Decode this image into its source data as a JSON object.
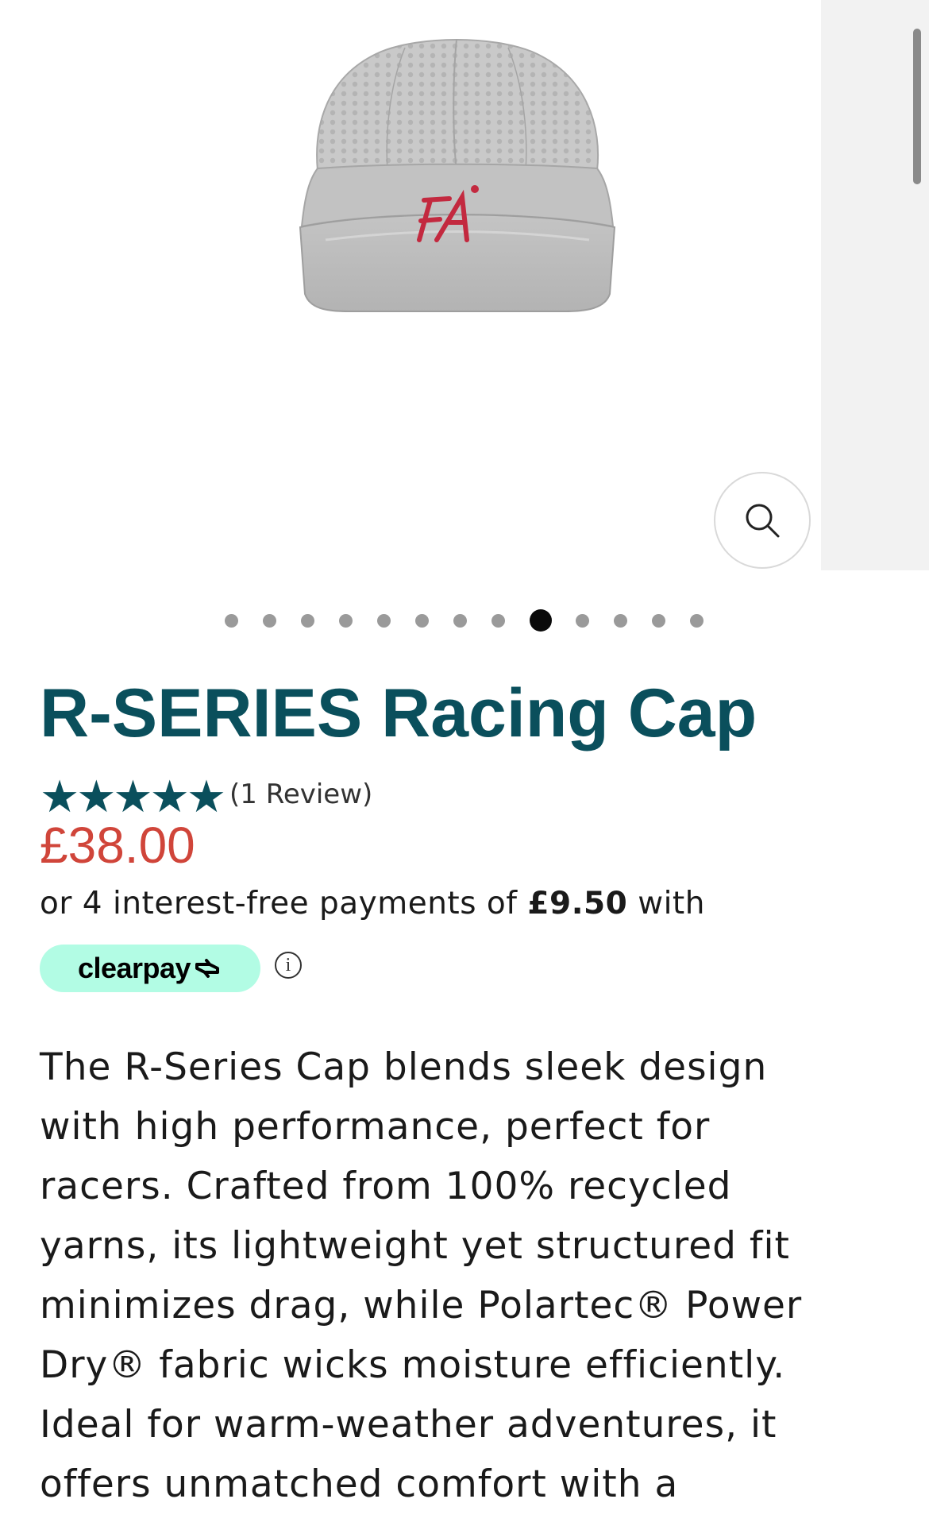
{
  "gallery": {
    "image_alt": "R-SERIES Racing Cap product image",
    "logo_text": "FA",
    "zoom_label": "Zoom",
    "slide_count": 13,
    "active_slide_index": 8
  },
  "product": {
    "title": "R-SERIES Racing Cap",
    "rating_stars": "★★★★★",
    "rating_value": 5,
    "review_count_text": "(1 Review)",
    "price": "£38.00"
  },
  "clearpay": {
    "prefix_text": "or 4 interest-free payments of ",
    "amount": "£9.50",
    "suffix_text": " with",
    "badge_text": "clearpay",
    "info_symbol": "i"
  },
  "description_lines": [
    "The R-Series Cap blends sleek design",
    "with high performance, perfect for",
    "racers. Crafted from 100% recycled",
    "yarns, its lightweight yet structured fit",
    "minimizes drag, while Polartec® Power",
    "Dry® fabric wicks moisture efficiently.",
    "Ideal for warm-weather adventures, it",
    "offers unmatched comfort with a"
  ],
  "colors": {
    "title": "#0a4f5c",
    "price": "#d0453a",
    "clearpay_badge": "#b2fce4",
    "cap_logo": "#c3293f"
  }
}
